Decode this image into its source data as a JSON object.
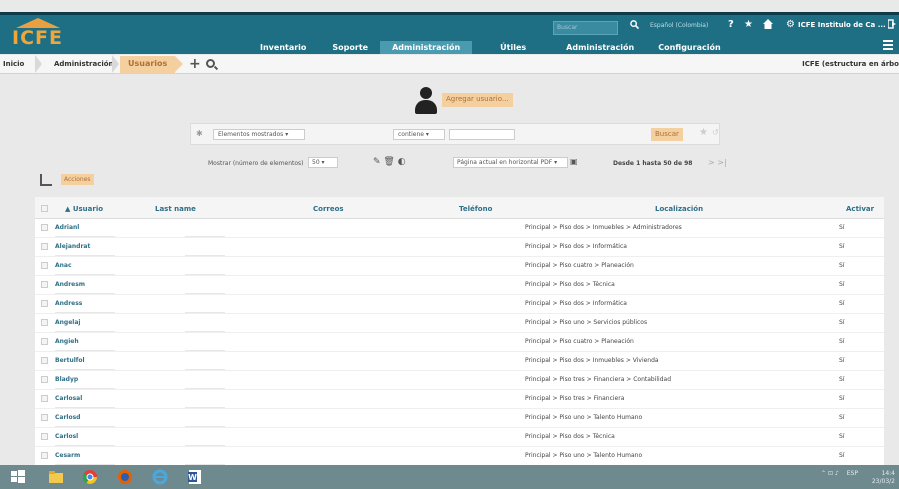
{
  "header": {
    "logo_text": "ICFE",
    "search_placeholder": "Buscar",
    "language": "Español (Colombia)",
    "help_icon": "?",
    "user_link": "ICFE Institulo de Ca ...",
    "nav": [
      "Inventario",
      "Soporte",
      "Administración",
      "Útiles",
      "Administración",
      "Configuración"
    ],
    "active_nav_index": 2
  },
  "breadcrumb": {
    "items": [
      "Inicio",
      "Administración",
      "Usuarios"
    ],
    "right_text": "ICFE (estructura en árbo"
  },
  "page": {
    "add_user_button": "Agregar usuario...",
    "filter": {
      "field_select": "Elementos mostrados",
      "operator_select": "contiene",
      "value": "",
      "search_button": "Buscar"
    },
    "options": {
      "show_label": "Mostrar (número de elementos)",
      "per_page": "50",
      "export_select": "Página actual en horizontal PDF",
      "range_text": "Desde 1 hasta 50 de 98",
      "pager": "> >|"
    },
    "actions_button": "Acciones"
  },
  "table": {
    "headers": {
      "usuario": "▲ Usuario",
      "last_name": "Last name",
      "correos": "Correos",
      "telefono": "Teléfono",
      "localizacion": "Localización",
      "activar": "Activar"
    },
    "rows": [
      {
        "usuario": "Adrianl",
        "localizacion": "Principal > Piso dos > Inmuebles > Administradores",
        "activar": "Sí"
      },
      {
        "usuario": "Alejandrat",
        "localizacion": "Principal > Piso dos > Informática",
        "activar": "Sí"
      },
      {
        "usuario": "Anac",
        "localizacion": "Principal > Piso cuatro > Planeación",
        "activar": "Sí"
      },
      {
        "usuario": "Andresm",
        "localizacion": "Principal > Piso dos > Técnica",
        "activar": "Sí"
      },
      {
        "usuario": "Andress",
        "localizacion": "Principal > Piso dos > Informática",
        "activar": "Sí"
      },
      {
        "usuario": "Angelaj",
        "localizacion": "Principal > Piso uno > Servicios públicos",
        "activar": "Sí"
      },
      {
        "usuario": "Angieh",
        "localizacion": "Principal > Piso cuatro > Planeación",
        "activar": "Sí"
      },
      {
        "usuario": "Bertulfol",
        "localizacion": "Principal > Piso dos > Inmuebles > Vivienda",
        "activar": "Sí"
      },
      {
        "usuario": "Bladyp",
        "localizacion": "Principal > Piso tres > Financiera > Contabilidad",
        "activar": "Sí"
      },
      {
        "usuario": "Carlosal",
        "localizacion": "Principal > Piso tres > Financiera",
        "activar": "Sí"
      },
      {
        "usuario": "Carlosd",
        "localizacion": "Principal > Piso uno > Talento Humano",
        "activar": "Sí"
      },
      {
        "usuario": "Carlosl",
        "localizacion": "Principal > Piso dos > Técnica",
        "activar": "Sí"
      },
      {
        "usuario": "Cesarm",
        "localizacion": "Principal > Piso uno > Talento Humano",
        "activar": "Sí"
      }
    ]
  },
  "taskbar": {
    "tray_lang": "ESP",
    "clock_time": "14:4",
    "clock_date": "23/03/2"
  },
  "colors": {
    "header_bg": "#1f6f84",
    "accent_orange": "#f4cfa0",
    "link_blue": "#2f6f86"
  }
}
